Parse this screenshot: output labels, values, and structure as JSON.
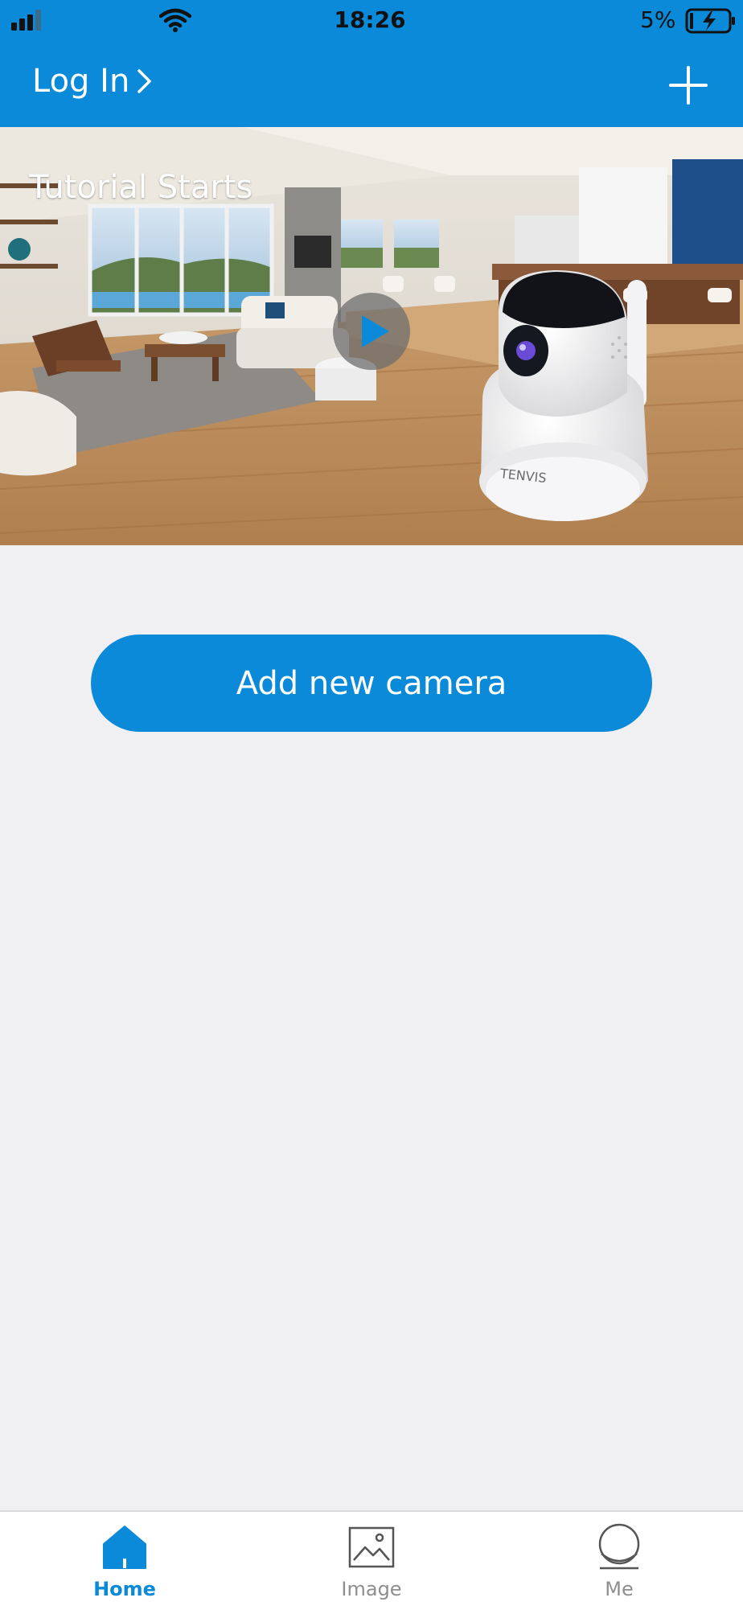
{
  "status_bar": {
    "time": "18:26",
    "battery_percent": "5%"
  },
  "header": {
    "login_label": "Log In",
    "login_icon": "chevron-right-icon",
    "add_icon": "plus-icon",
    "background_color": "#0a8ad8"
  },
  "hero": {
    "title": "Tutorial Starts",
    "play_icon": "play-icon",
    "brand_on_camera": "TENVIS"
  },
  "main": {
    "add_camera_label": "Add new camera"
  },
  "tabbar": {
    "tabs": [
      {
        "label": "Home",
        "icon": "home-icon",
        "active": true
      },
      {
        "label": "Image",
        "icon": "image-icon",
        "active": false
      },
      {
        "label": "Me",
        "icon": "profile-icon",
        "active": false
      }
    ]
  },
  "colors": {
    "accent": "#0a8ad8",
    "background": "#f0f0f2",
    "inactive_tab": "#8e8e8e"
  }
}
